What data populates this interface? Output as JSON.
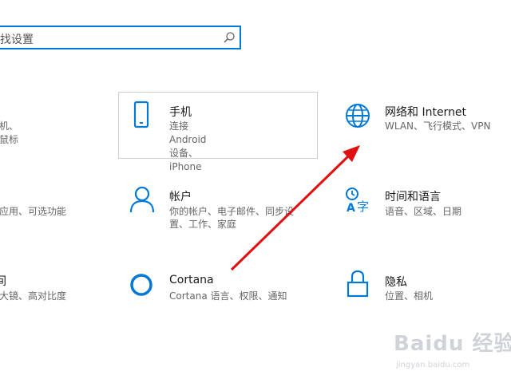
{
  "search": {
    "value": "找设置"
  },
  "tiles": {
    "devices_partial": {
      "desc": "机、鼠标"
    },
    "phone": {
      "title": "手机",
      "desc": "连接 Android 设备、iPhone"
    },
    "network": {
      "title": "网络和 Internet",
      "desc": "WLAN、飞行模式、VPN"
    },
    "apps_partial": {
      "desc": "应用、可选功能"
    },
    "accounts": {
      "title": "帐户",
      "desc_line1": "你的帐户、电子邮件、同步设",
      "desc_line2": "置、工作、家庭"
    },
    "time_language": {
      "title": "时间和语言",
      "desc": "语音、区域、日期"
    },
    "gaming_partial": {
      "title": "间",
      "desc": "大镜、高对比度"
    },
    "cortana": {
      "title": "Cortana",
      "desc": "Cortana 语言、权限、通知"
    },
    "privacy": {
      "title": "隐私",
      "desc": "位置、相机"
    }
  },
  "icons": {
    "search": "search-icon",
    "phone": "phone-icon",
    "network": "globe-icon",
    "accounts": "person-icon",
    "time_language": "language-icon",
    "cortana": "cortana-circle-icon",
    "privacy": "lock-icon"
  },
  "colors": {
    "accent": "#0078d7",
    "annotation_arrow": "#e01010"
  },
  "watermark": {
    "brand": "Baidu 经验",
    "url": "jingyan.baidu.com"
  }
}
